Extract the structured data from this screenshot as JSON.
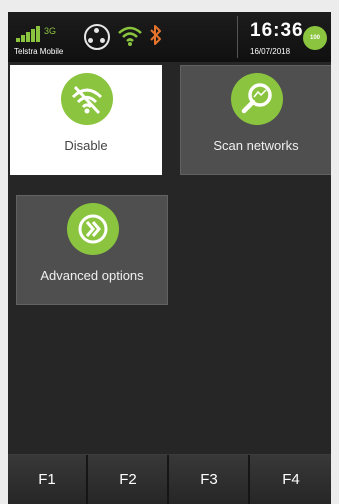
{
  "status_bar": {
    "network_type": "3G",
    "operator": "Telstra Mobile",
    "time": "16:36",
    "date": "16/07/2018",
    "battery_label": "100"
  },
  "tiles": [
    {
      "label": "Disable",
      "icon": "wifi-off-icon",
      "selected": true
    },
    {
      "label": "Scan networks",
      "icon": "magnifier-icon",
      "selected": false
    },
    {
      "label": "Advanced options",
      "icon": "forward-icon",
      "selected": false
    }
  ],
  "function_keys": [
    "F1",
    "F2",
    "F3",
    "F4"
  ],
  "colors": {
    "accent": "#8bc53f",
    "background": "#262626",
    "tile": "#4f4f4f",
    "selected_tile": "#ffffff"
  }
}
